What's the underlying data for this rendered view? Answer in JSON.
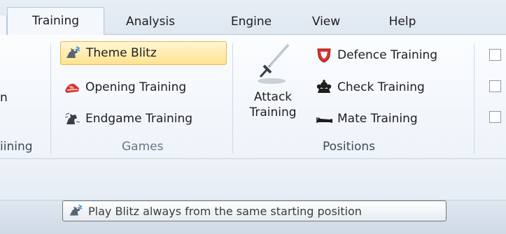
{
  "tabs": [
    {
      "label": "Training",
      "active": true
    },
    {
      "label": "Analysis",
      "active": false
    },
    {
      "label": "Engine",
      "active": false
    },
    {
      "label": "View",
      "active": false
    },
    {
      "label": "Help",
      "active": false
    }
  ],
  "left_clipped": {
    "button_fragment": "n",
    "group_fragment": "iining"
  },
  "games_group": {
    "label": "Games",
    "buttons": [
      {
        "label": "Theme Blitz",
        "icon": "blitz-knight-icon",
        "highlighted": true
      },
      {
        "label": "Opening Training",
        "icon": "opening-shoe-icon"
      },
      {
        "label": "Endgame Training",
        "icon": "endgame-knight-icon"
      }
    ]
  },
  "positions_group": {
    "label": "Positions",
    "attack": {
      "line1": "Attack",
      "line2": "Training",
      "icon": "sword-icon"
    },
    "buttons": [
      {
        "label": "Defence Training",
        "icon": "shield-icon"
      },
      {
        "label": "Check Training",
        "icon": "crown-icon"
      },
      {
        "label": "Mate Training",
        "icon": "fallen-king-icon"
      }
    ]
  },
  "right_checkboxes": [
    {
      "checked": false
    },
    {
      "checked": false
    },
    {
      "checked": false
    }
  ],
  "tooltip": {
    "text": "Play Blitz always from the same starting position",
    "icon": "blitz-knight-icon"
  },
  "colors": {
    "highlight_fill": "#ffe390",
    "highlight_border": "#e8b84a",
    "ribbon_bg": "#eef3f9",
    "shield": "#d9342b"
  }
}
